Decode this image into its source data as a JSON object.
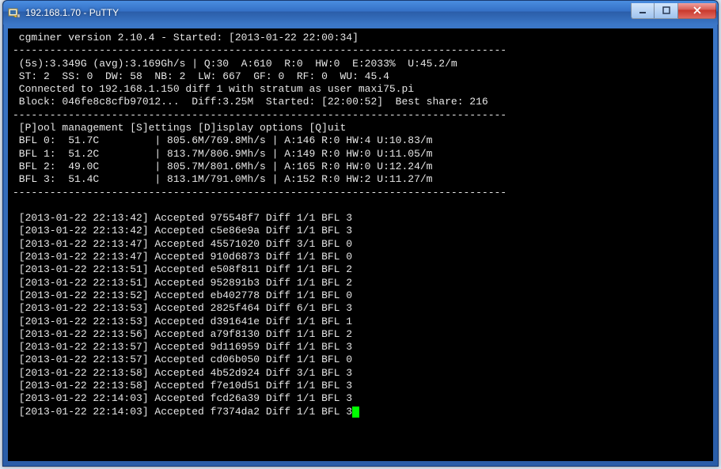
{
  "window_title": "192.168.1.70 - PuTTY",
  "header_line": " cgminer version 2.10.4 - Started: [2013-01-22 22:00:34]",
  "dash": "--------------------------------------------------------------------------------",
  "stat_line1": " (5s):3.349G (avg):3.169Gh/s | Q:30  A:610  R:0  HW:0  E:2033%  U:45.2/m",
  "stat_line2": " ST: 2  SS: 0  DW: 58  NB: 2  LW: 667  GF: 0  RF: 0  WU: 45.4",
  "stat_line3": " Connected to 192.168.1.150 diff 1 with stratum as user maxi75.pi",
  "stat_line4": " Block: 046fe8c8cfb97012...  Diff:3.25M  Started: [22:00:52]  Best share: 216",
  "menu_line": " [P]ool management [S]ettings [D]isplay options [Q]uit",
  "devices": [
    " BFL 0:  51.7C         | 805.6M/769.8Mh/s | A:146 R:0 HW:4 U:10.83/m",
    " BFL 1:  51.2C         | 813.7M/806.9Mh/s | A:149 R:0 HW:0 U:11.05/m",
    " BFL 2:  49.0C         | 805.7M/801.6Mh/s | A:165 R:0 HW:0 U:12.24/m",
    " BFL 3:  51.4C         | 813.1M/791.0Mh/s | A:152 R:0 HW:2 U:11.27/m"
  ],
  "log": [
    " [2013-01-22 22:13:42] Accepted 975548f7 Diff 1/1 BFL 3",
    " [2013-01-22 22:13:42] Accepted c5e86e9a Diff 1/1 BFL 3",
    " [2013-01-22 22:13:47] Accepted 45571020 Diff 3/1 BFL 0",
    " [2013-01-22 22:13:47] Accepted 910d6873 Diff 1/1 BFL 0",
    " [2013-01-22 22:13:51] Accepted e508f811 Diff 1/1 BFL 2",
    " [2013-01-22 22:13:51] Accepted 952891b3 Diff 1/1 BFL 2",
    " [2013-01-22 22:13:52] Accepted eb402778 Diff 1/1 BFL 0",
    " [2013-01-22 22:13:53] Accepted 2825f464 Diff 6/1 BFL 3",
    " [2013-01-22 22:13:53] Accepted d391641e Diff 1/1 BFL 1",
    " [2013-01-22 22:13:56] Accepted a79f8130 Diff 1/1 BFL 2",
    " [2013-01-22 22:13:57] Accepted 9d116959 Diff 1/1 BFL 3",
    " [2013-01-22 22:13:57] Accepted cd06b050 Diff 1/1 BFL 0",
    " [2013-01-22 22:13:58] Accepted 4b52d924 Diff 3/1 BFL 3",
    " [2013-01-22 22:13:58] Accepted f7e10d51 Diff 1/1 BFL 3",
    " [2013-01-22 22:14:03] Accepted fcd26a39 Diff 1/1 BFL 3"
  ],
  "last_line": " [2013-01-22 22:14:03] Accepted f7374da2 Diff 1/1 BFL 3"
}
